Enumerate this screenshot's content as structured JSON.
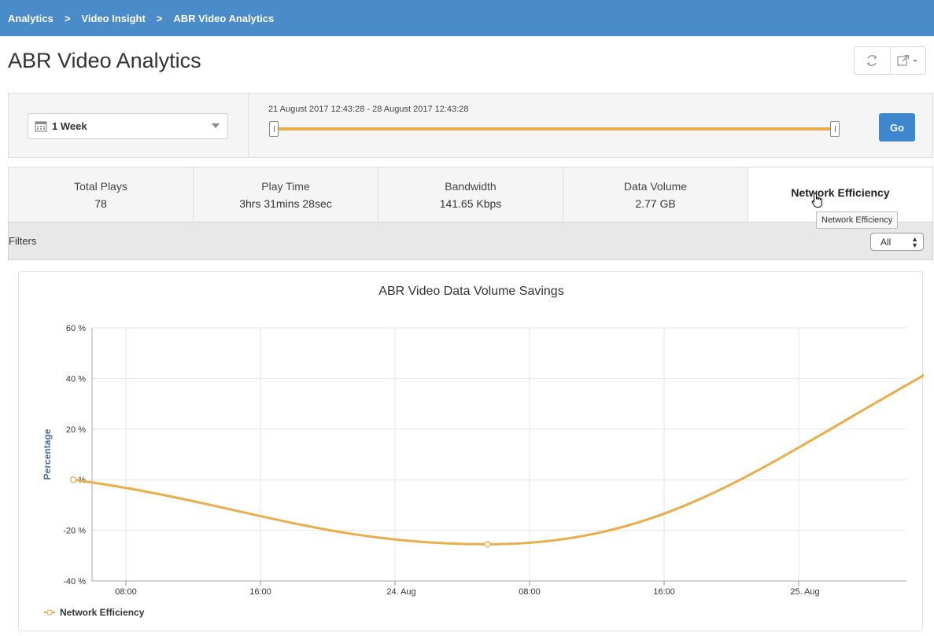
{
  "breadcrumb": {
    "items": [
      "Analytics",
      "Video Insight",
      "ABR Video Analytics"
    ],
    "separator": ">"
  },
  "page": {
    "title": "ABR Video Analytics"
  },
  "time_panel": {
    "period": "1 Week",
    "range_text": "21 August 2017 12:43:28 - 28 August 2017 12:43:28",
    "go_label": "Go"
  },
  "metrics": [
    {
      "label": "Total Plays",
      "value": "78"
    },
    {
      "label": "Play Time",
      "value": "3hrs 31mins 28sec"
    },
    {
      "label": "Bandwidth",
      "value": "141.65 Kbps"
    },
    {
      "label": "Data Volume",
      "value": "2.77 GB"
    },
    {
      "label": "Network Efficiency",
      "value": ""
    }
  ],
  "active_metric": "Network Efficiency",
  "tooltip": "Network Efficiency",
  "filters": {
    "label": "Filters",
    "selected": "All"
  },
  "colors": {
    "header": "#4a8bc9",
    "accent": "#e9ad4a",
    "go": "#3d87cf",
    "axis_label": "#4a6f9e"
  },
  "chart_data": {
    "type": "line",
    "title": "ABR Video Data Volume Savings",
    "ylabel": "Percentage",
    "xlabel": "",
    "ylim": [
      -40,
      60
    ],
    "yticks": [
      "60 %",
      "40 %",
      "20 %",
      "0 %",
      "-20 %",
      "-40 %"
    ],
    "xticks": [
      "08:00",
      "16:00",
      "24. Aug",
      "08:00",
      "16:00",
      "25. Aug"
    ],
    "grid": true,
    "legend_position": "bottom-left",
    "series": [
      {
        "name": "Network Efficiency",
        "color": "#e9ad4a",
        "points": [
          {
            "x": "23 Aug 04:52",
            "y": 0
          },
          {
            "x": "24 Aug 05:30",
            "y": -25.5
          },
          {
            "x": "25 Aug 09:00",
            "y": 47
          }
        ]
      }
    ]
  }
}
